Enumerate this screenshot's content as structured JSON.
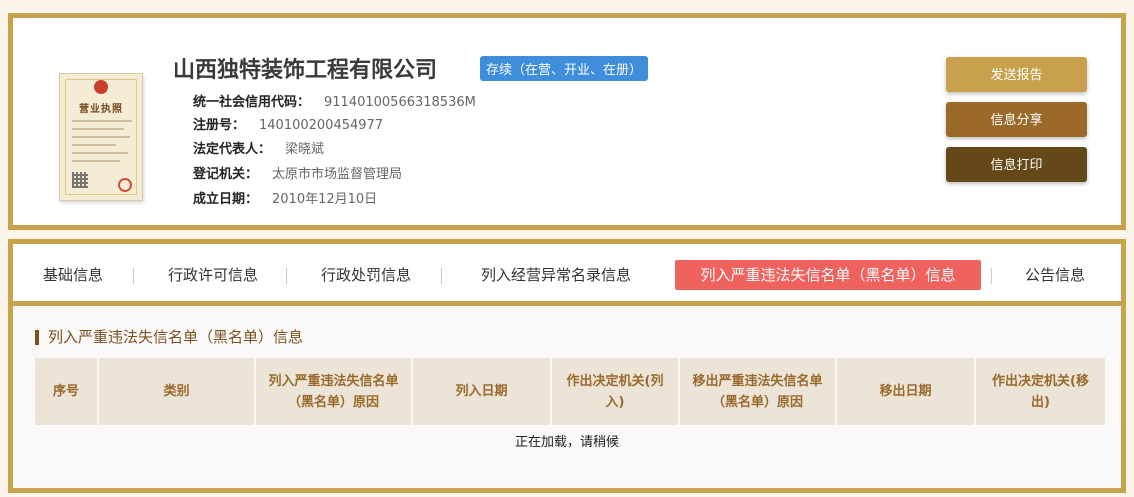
{
  "company": {
    "name": "山西独特装饰工程有限公司",
    "status": "存续（在营、开业、在册）"
  },
  "license_image": {
    "title": "营业执照"
  },
  "info": [
    {
      "label": "统一社会信用代码：",
      "value": "91140100566318536M"
    },
    {
      "label": "注册号：",
      "value": "140100200454977"
    },
    {
      "label": "法定代表人：",
      "value": "梁晓斌"
    },
    {
      "label": "登记机关：",
      "value": "太原市市场监督管理局"
    },
    {
      "label": "成立日期：",
      "value": "2010年12月10日"
    }
  ],
  "actions": {
    "send_report": "发送报告",
    "share_info": "信息分享",
    "print_info": "信息打印"
  },
  "tabs": [
    {
      "label": "基础信息"
    },
    {
      "label": "行政许可信息"
    },
    {
      "label": "行政处罚信息"
    },
    {
      "label": "列入经营异常名录信息"
    },
    {
      "label": "列入严重违法失信名单（黑名单）信息"
    },
    {
      "label": "公告信息"
    }
  ],
  "section": {
    "title": "列入严重违法失信名单（黑名单）信息",
    "columns": [
      "序号",
      "类别",
      "列入严重违法失信名单（黑名单）原因",
      "列入日期",
      "作出决定机关(列入)",
      "移出严重违法失信名单（黑名单）原因",
      "移出日期",
      "作出决定机关(移出)"
    ],
    "loading_text": "正在加载，请稍候"
  },
  "colors": {
    "border_gold": "#c9a34c",
    "status_blue": "#3e8edb",
    "active_tab": "#f0625d",
    "send_button": "#c9a04c",
    "share_button": "#9c6a28",
    "print_button": "#654818"
  }
}
